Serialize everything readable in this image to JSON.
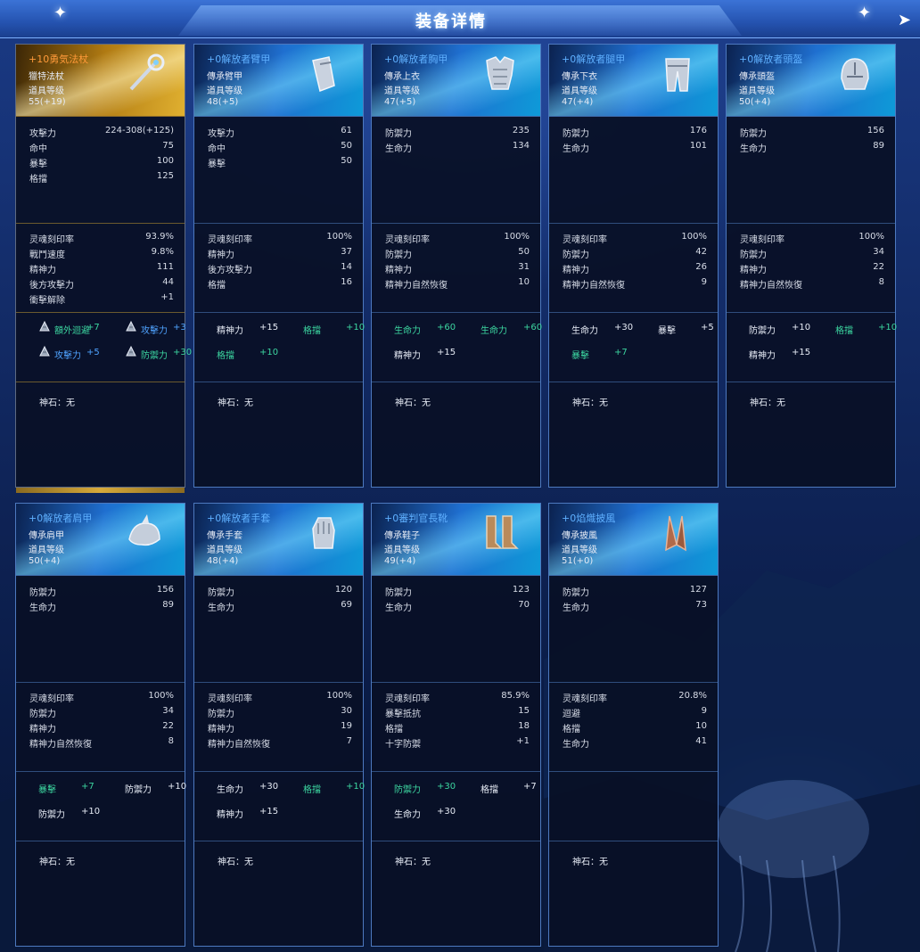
{
  "window": {
    "title": "装备详情",
    "close_icon": "arrow-close-icon"
  },
  "colors": {
    "blue_name": "#5fb0ff",
    "orange_name": "#ff9a3a",
    "green_bonus": "#3cd6a0"
  },
  "items": [
    {
      "name": "+10勇気法杖",
      "type": "獵特法杖",
      "level_label": "道具等级",
      "level": "55(+19)",
      "icon": "staff-icon",
      "base": [
        {
          "k": "攻擊力",
          "v": "224-308(+125)"
        },
        {
          "k": "命中",
          "v": "75"
        },
        {
          "k": "暴擊",
          "v": "100"
        },
        {
          "k": "格擋",
          "v": "125"
        }
      ],
      "quality": [
        {
          "k": "灵魂刻印率",
          "v": "93.9%"
        },
        {
          "k": "戰鬥速度",
          "v": "9.8%"
        },
        {
          "k": "精神力",
          "v": "111"
        },
        {
          "k": "後方攻擊力",
          "v": "44"
        },
        {
          "k": "衝擊解除",
          "v": "+1"
        }
      ],
      "extras": [
        {
          "n": "額外迴避",
          "b": "+7"
        },
        {
          "n": "攻擊力",
          "b": "+3"
        },
        {
          "n": "攻擊力",
          "b": "+5"
        },
        {
          "n": "防禦力",
          "b": "+30"
        }
      ],
      "stone": "神石：无"
    },
    {
      "name": "+0解放者臂甲",
      "type": "傳承臂甲",
      "level_label": "道具等级",
      "level": "48(+5)",
      "icon": "bracer-icon",
      "base": [
        {
          "k": "攻擊力",
          "v": "61"
        },
        {
          "k": "命中",
          "v": "50"
        },
        {
          "k": "暴擊",
          "v": "50"
        }
      ],
      "quality": [
        {
          "k": "灵魂刻印率",
          "v": "100%"
        },
        {
          "k": "精神力",
          "v": "37"
        },
        {
          "k": "後方攻擊力",
          "v": "14"
        },
        {
          "k": "格擋",
          "v": "16"
        }
      ],
      "extras": [
        {
          "n": "精神力",
          "b": "+15"
        },
        {
          "n": "格擋",
          "b": "+10"
        },
        {
          "n": "格擋",
          "b": "+10"
        }
      ],
      "stone": "神石：无"
    },
    {
      "name": "+0解放者胸甲",
      "type": "傳承上衣",
      "level_label": "道具等级",
      "level": "47(+5)",
      "icon": "chest-armor-icon",
      "base": [
        {
          "k": "防禦力",
          "v": "235"
        },
        {
          "k": "生命力",
          "v": "134"
        }
      ],
      "quality": [
        {
          "k": "灵魂刻印率",
          "v": "100%"
        },
        {
          "k": "防禦力",
          "v": "50"
        },
        {
          "k": "精神力",
          "v": "31"
        },
        {
          "k": "精神力自然恢復",
          "v": "10"
        }
      ],
      "extras": [
        {
          "n": "生命力",
          "b": "+60"
        },
        {
          "n": "生命力",
          "b": "+60"
        },
        {
          "n": "精神力",
          "b": "+15"
        }
      ],
      "stone": "神石：无"
    },
    {
      "name": "+0解放者腿甲",
      "type": "傳承下衣",
      "level_label": "道具等级",
      "level": "47(+4)",
      "icon": "leg-armor-icon",
      "base": [
        {
          "k": "防禦力",
          "v": "176"
        },
        {
          "k": "生命力",
          "v": "101"
        }
      ],
      "quality": [
        {
          "k": "灵魂刻印率",
          "v": "100%"
        },
        {
          "k": "防禦力",
          "v": "42"
        },
        {
          "k": "精神力",
          "v": "26"
        },
        {
          "k": "精神力自然恢復",
          "v": "9"
        }
      ],
      "extras": [
        {
          "n": "生命力",
          "b": "+30"
        },
        {
          "n": "暴擊",
          "b": "+5"
        },
        {
          "n": "暴擊",
          "b": "+7"
        }
      ],
      "stone": "神石：无"
    },
    {
      "name": "+0解放者頭盔",
      "type": "傳承頭盔",
      "level_label": "道具等级",
      "level": "50(+4)",
      "icon": "helmet-icon",
      "base": [
        {
          "k": "防禦力",
          "v": "156"
        },
        {
          "k": "生命力",
          "v": "89"
        }
      ],
      "quality": [
        {
          "k": "灵魂刻印率",
          "v": "100%"
        },
        {
          "k": "防禦力",
          "v": "34"
        },
        {
          "k": "精神力",
          "v": "22"
        },
        {
          "k": "精神力自然恢復",
          "v": "8"
        }
      ],
      "extras": [
        {
          "n": "防禦力",
          "b": "+10"
        },
        {
          "n": "格擋",
          "b": "+10"
        },
        {
          "n": "精神力",
          "b": "+15"
        }
      ],
      "stone": "神石：无"
    },
    {
      "name": "+0解放者肩甲",
      "type": "傳承肩甲",
      "level_label": "道具等级",
      "level": "50(+4)",
      "icon": "shoulder-armor-icon",
      "base": [
        {
          "k": "防禦力",
          "v": "156"
        },
        {
          "k": "生命力",
          "v": "89"
        }
      ],
      "quality": [
        {
          "k": "灵魂刻印率",
          "v": "100%"
        },
        {
          "k": "防禦力",
          "v": "34"
        },
        {
          "k": "精神力",
          "v": "22"
        },
        {
          "k": "精神力自然恢復",
          "v": "8"
        }
      ],
      "extras": [
        {
          "n": "暴擊",
          "b": "+7"
        },
        {
          "n": "防禦力",
          "b": "+10"
        },
        {
          "n": "防禦力",
          "b": "+10"
        }
      ],
      "stone": "神石：无"
    },
    {
      "name": "+0解放者手套",
      "type": "傳承手套",
      "level_label": "道具等级",
      "level": "48(+4)",
      "icon": "gauntlet-icon",
      "base": [
        {
          "k": "防禦力",
          "v": "120"
        },
        {
          "k": "生命力",
          "v": "69"
        }
      ],
      "quality": [
        {
          "k": "灵魂刻印率",
          "v": "100%"
        },
        {
          "k": "防禦力",
          "v": "30"
        },
        {
          "k": "精神力",
          "v": "19"
        },
        {
          "k": "精神力自然恢復",
          "v": "7"
        }
      ],
      "extras": [
        {
          "n": "生命力",
          "b": "+30"
        },
        {
          "n": "格擋",
          "b": "+10"
        },
        {
          "n": "精神力",
          "b": "+15"
        }
      ],
      "stone": "神石：无"
    },
    {
      "name": "+0審判官長靴",
      "type": "傳承鞋子",
      "level_label": "道具等级",
      "level": "49(+4)",
      "icon": "boots-icon",
      "base": [
        {
          "k": "防禦力",
          "v": "123"
        },
        {
          "k": "生命力",
          "v": "70"
        }
      ],
      "quality": [
        {
          "k": "灵魂刻印率",
          "v": "85.9%"
        },
        {
          "k": "暴擊抵抗",
          "v": "15"
        },
        {
          "k": "格擋",
          "v": "18"
        },
        {
          "k": "十字防禦",
          "v": "+1"
        }
      ],
      "extras": [
        {
          "n": "防禦力",
          "b": "+30"
        },
        {
          "n": "格擋",
          "b": "+7"
        },
        {
          "n": "生命力",
          "b": "+30"
        }
      ],
      "stone": "神石：无"
    },
    {
      "name": "+0焰熾披風",
      "type": "傳承披風",
      "level_label": "道具等级",
      "level": "51(+0)",
      "icon": "cloak-icon",
      "base": [
        {
          "k": "防禦力",
          "v": "127"
        },
        {
          "k": "生命力",
          "v": "73"
        }
      ],
      "quality": [
        {
          "k": "灵魂刻印率",
          "v": "20.8%"
        },
        {
          "k": "迴避",
          "v": "9"
        },
        {
          "k": "格擋",
          "v": "10"
        },
        {
          "k": "生命力",
          "v": "41"
        }
      ],
      "extras": [],
      "stone": "神石：无"
    }
  ]
}
